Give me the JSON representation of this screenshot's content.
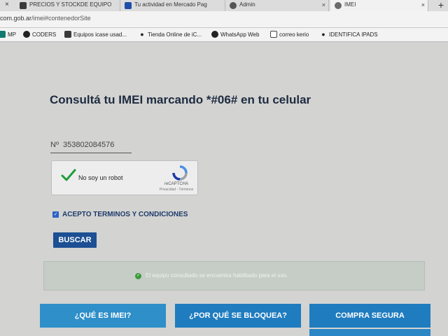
{
  "browser": {
    "tabs": [
      {
        "label": "PRECIOS Y STOCKDE EQUIPO",
        "active": false
      },
      {
        "label": "Tu actividad en Mercado Pag",
        "active": false
      },
      {
        "label": "Admin",
        "active": false
      },
      {
        "label": "IMEI",
        "active": true
      }
    ],
    "close_glyph": "×",
    "new_tab_glyph": "+",
    "url_host": "com.gob.ar",
    "url_path": "/imei#contenedorSite",
    "bookmarks": [
      {
        "label": "MP",
        "icon": "mercadopago-icon"
      },
      {
        "label": "CODERS",
        "icon": "github-icon"
      },
      {
        "label": "Equipos icase usad...",
        "icon": "bookmark-page-icon"
      },
      {
        "label": "Tienda Online de iC...",
        "icon": "apple-icon"
      },
      {
        "label": "WhatsApp Web",
        "icon": "whatsapp-icon"
      },
      {
        "label": "correo kerio",
        "icon": "mail-icon"
      },
      {
        "label": "IDENTIFICA IPADS",
        "icon": "apple-icon"
      }
    ]
  },
  "page": {
    "title": "Consultá tu IMEI marcando *#06# en tu celular",
    "imei_prefix": "Nº",
    "imei_value": "353802084576",
    "captcha": {
      "label": "No soy un robot",
      "brand": "reCAPTCHA",
      "links": "Privacidad - Términos",
      "checked": true
    },
    "terms_label": "ACEPTO TERMINOS Y CONDICIONES",
    "search_button": "BUSCAR",
    "result_message": "El equipo consultado se encuentra habilitado para el uso.",
    "nav_buttons": [
      "¿QUÉ ES IMEI?",
      "¿POR QUÉ SE BLOQUEA?",
      "COMPRA SEGURA"
    ]
  },
  "colors": {
    "primary_button": "#1c4f93",
    "nav_button": "#2e8fc9",
    "success": "#3c9a3c"
  }
}
